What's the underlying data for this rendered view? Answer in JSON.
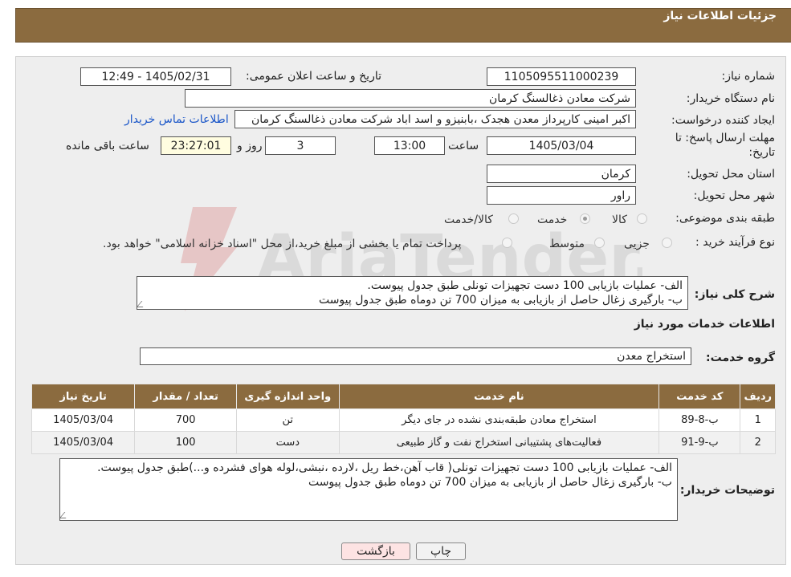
{
  "header": {
    "title": "جزئیات اطلاعات نیاز"
  },
  "form": {
    "need_number_label": "شماره نیاز:",
    "need_number": "1105095511000239",
    "announce_label": "تاریخ و ساعت اعلان عمومی:",
    "announce_value": "1405/02/31 - 12:49",
    "buyer_org_label": "نام دستگاه خریدار:",
    "buyer_org": "شرکت معادن ذغالسنگ کرمان",
    "creator_label": "ایجاد کننده درخواست:",
    "creator": "اکبر امینی کارپرداز معدن هجدک ،بابنیزو و اسد اباد شرکت معادن ذغالسنگ کرمان",
    "contact_link": "اطلاعات تماس خریدار",
    "deadline_label_line1": "مهلت ارسال پاسخ: تا",
    "deadline_label_line2": "تاریخ:",
    "deadline_date": "1405/03/04",
    "hour_label": "ساعت",
    "deadline_time": "13:00",
    "days_value": "3",
    "days_label": "روز و",
    "remaining_time": "23:27:01",
    "remaining_label": "ساعت باقی مانده",
    "province_label": "استان محل تحویل:",
    "province": "کرمان",
    "city_label": "شهر محل تحویل:",
    "city": "راور",
    "category_label": "طبقه بندی موضوعی:",
    "category_options": [
      "کالا",
      "خدمت",
      "کالا/خدمت"
    ],
    "category_selected": "خدمت",
    "process_label": "نوع فرآیند خرید :",
    "process_options": [
      "جزیی",
      "متوسط"
    ],
    "payment_note": "پرداخت تمام یا بخشی از مبلغ خرید،از محل \"اسناد خزانه اسلامی\" خواهد بود."
  },
  "summary": {
    "label": "شرح کلی نیاز:",
    "line1": "الف- عملیات بازیابی 100 دست تجهیزات تونلی طبق جدول پیوست.",
    "line2": "ب- بارگیری زغال حاصل از بازیابی به میزان 700 تن دوماه طبق جدول پیوست"
  },
  "services_section": {
    "title": "اطلاعات خدمات مورد نیاز",
    "group_label": "گروه خدمت:",
    "group_value": "استخراج معدن"
  },
  "table": {
    "headers": [
      "ردیف",
      "کد خدمت",
      "نام خدمت",
      "واحد اندازه گیری",
      "تعداد / مقدار",
      "تاریخ نیاز"
    ],
    "rows": [
      [
        "1",
        "ب-8-89",
        "استخراج معادن طبقه‌بندی نشده در جای دیگر",
        "تن",
        "700",
        "1405/03/04"
      ],
      [
        "2",
        "ب-9-91",
        "فعالیت‌های پشتیبانی استخراج نفت و گاز طبیعی",
        "دست",
        "100",
        "1405/03/04"
      ]
    ]
  },
  "buyer_notes": {
    "label": "توضیحات خریدار:",
    "line1": "الف- عملیات بازیابی 100 دست تجهیزات تونلی( قاب آهن،خط ریل ،لارده ،نبشی،لوله هوای فشرده و...)طبق جدول پیوست.",
    "line2": "ب- بارگیری زغال حاصل از بازیابی به میزان 700 تن دوماه طبق جدول پیوست"
  },
  "buttons": {
    "print": "چاپ",
    "back": "بازگشت"
  },
  "watermark_text": "AriaTender.neT",
  "colors": {
    "header_bg": "#8b6b3f",
    "link": "#1a56c8",
    "back_button_bg": "#fde3e3"
  }
}
